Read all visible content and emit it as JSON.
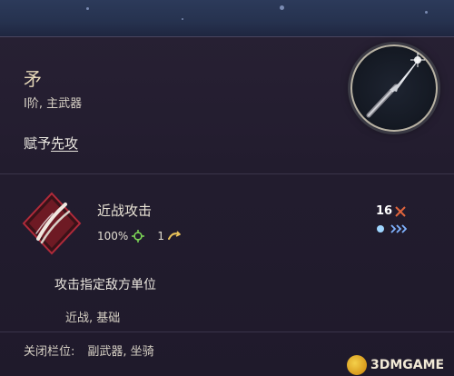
{
  "item": {
    "name": "矛",
    "subtitle": "I阶, 主武器",
    "grant_prefix": "赋予",
    "grant_link": "先攻",
    "icon": "spear-icon"
  },
  "ability": {
    "name": "近战攻击",
    "accuracy": "100%",
    "accuracy_icon": "crosshair-icon",
    "cost": "1",
    "cost_icon": "action-point-icon",
    "range": "16",
    "range_icon": "crossed-swords-icon",
    "speed_icons": "chevrons-icon",
    "icon": "slash-ability-icon",
    "description": "攻击指定敌方单位",
    "tags": "近战, 基础"
  },
  "closed_slots": {
    "label": "关闭栏位:",
    "value": "副武器, 坐骑"
  },
  "watermark": "3DMGAME",
  "colors": {
    "panel": "#221c2e",
    "title": "#e6d8b8",
    "accent_red": "#c0283c",
    "chevron_blue": "#7fb3ff",
    "orb": "#9fd6ff"
  }
}
